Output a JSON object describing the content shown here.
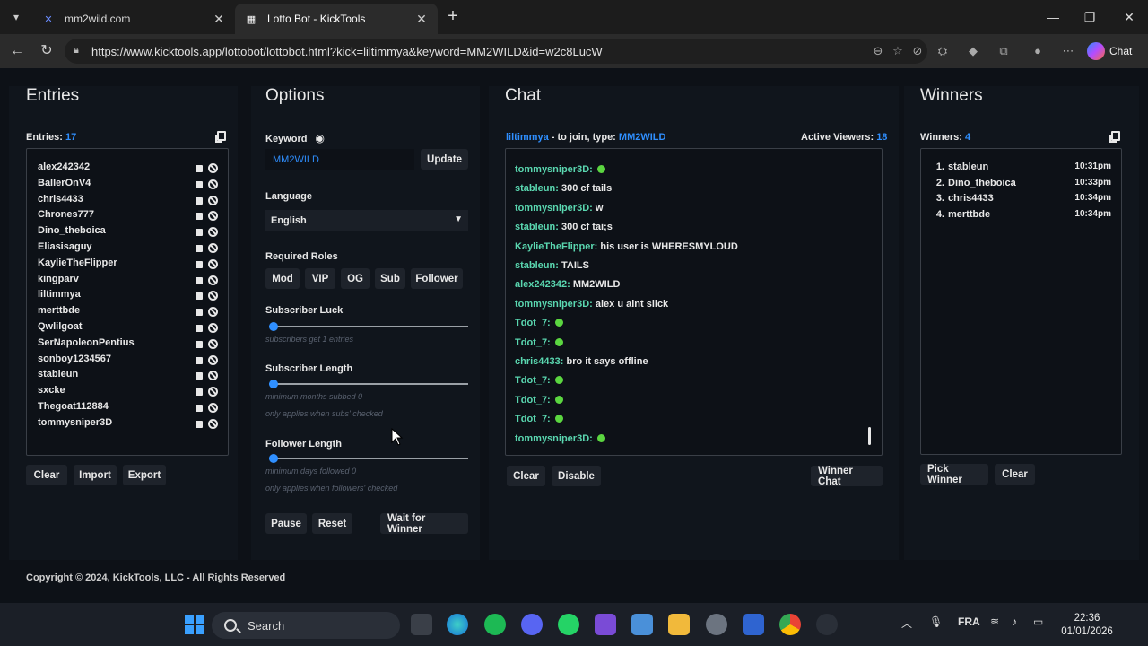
{
  "browser": {
    "tabs": [
      {
        "title": "mm2wild.com"
      },
      {
        "title": "Lotto Bot - KickTools"
      }
    ],
    "url": "https://www.kicktools.app/lottobot/lottobot.html?kick=liltimmya&keyword=MM2WILD&id=w2c8LucW",
    "copilot_label": "Chat"
  },
  "entries": {
    "title": "Entries",
    "count_label": "Entries:",
    "count": "17",
    "items": [
      "alex242342",
      "BallerOnV4",
      "chris4433",
      "Chrones777",
      "Dino_theboica",
      "Eliasisaguy",
      "KaylieTheFlipper",
      "kingparv",
      "liltimmya",
      "merttbde",
      "Qwlilgoat",
      "SerNapoleonPentius",
      "sonboy1234567",
      "stableun",
      "sxcke",
      "Thegoat112884",
      "tommysniper3D"
    ],
    "buttons": {
      "clear": "Clear",
      "import": "Import",
      "export": "Export"
    }
  },
  "options": {
    "title": "Options",
    "keyword_label": "Keyword",
    "keyword_value": "MM2WILD",
    "update_label": "Update",
    "language_label": "Language",
    "language_value": "English",
    "roles_label": "Required Roles",
    "roles": [
      "Mod",
      "VIP",
      "OG",
      "Sub",
      "Follower"
    ],
    "sub_luck_label": "Subscriber Luck",
    "sub_luck_hint": "subscribers get 1 entries",
    "sub_luck_value": 0,
    "sub_length_label": "Subscriber Length",
    "sub_length_hint": "minimum months subbed 0",
    "sub_length_hint2": "only applies when subs' checked",
    "sub_length_value": 0,
    "follower_length_label": "Follower Length",
    "follower_length_hint": "minimum days followed 0",
    "follower_length_hint2": "only applies when followers' checked",
    "follower_length_value": 0,
    "buttons": {
      "pause": "Pause",
      "reset": "Reset",
      "wait": "Wait for Winner"
    }
  },
  "chat": {
    "title": "Chat",
    "channel": "liltimmya",
    "join_text": " - to join, type: ",
    "keyword": "MM2WILD",
    "viewers_label": "Active Viewers:",
    "viewers_count": "18",
    "messages": [
      {
        "user": "tommysniper3D:",
        "text": "",
        "emote": true
      },
      {
        "user": "stableun:",
        "text": "300 cf tails",
        "emote": false
      },
      {
        "user": "tommysniper3D:",
        "text": "w",
        "emote": false
      },
      {
        "user": "stableun:",
        "text": "300 cf tai;s",
        "emote": false
      },
      {
        "user": "KaylieTheFlipper:",
        "text": "his user is WHERESMYLOUD",
        "emote": false
      },
      {
        "user": "stableun:",
        "text": "TAILS",
        "emote": false
      },
      {
        "user": "alex242342:",
        "text": "MM2WILD",
        "emote": false
      },
      {
        "user": "tommysniper3D:",
        "text": "alex u aint slick",
        "emote": false
      },
      {
        "user": "Tdot_7:",
        "text": "",
        "emote": true
      },
      {
        "user": "Tdot_7:",
        "text": "",
        "emote": true
      },
      {
        "user": "chris4433:",
        "text": "bro it says offline",
        "emote": false
      },
      {
        "user": "Tdot_7:",
        "text": "",
        "emote": true
      },
      {
        "user": "Tdot_7:",
        "text": "",
        "emote": true
      },
      {
        "user": "Tdot_7:",
        "text": "",
        "emote": true
      },
      {
        "user": "tommysniper3D:",
        "text": "",
        "emote": true
      }
    ],
    "buttons": {
      "clear": "Clear",
      "disable": "Disable",
      "winner_chat": "Winner Chat"
    }
  },
  "winners": {
    "title": "Winners",
    "count_label": "Winners:",
    "count": "4",
    "items": [
      {
        "rank": "1.",
        "name": "stableun",
        "time": "10:31pm"
      },
      {
        "rank": "2.",
        "name": "Dino_theboica",
        "time": "10:33pm"
      },
      {
        "rank": "3.",
        "name": "chris4433",
        "time": "10:34pm"
      },
      {
        "rank": "4.",
        "name": "merttbde",
        "time": "10:34pm"
      }
    ],
    "buttons": {
      "pick": "Pick Winner",
      "clear": "Clear"
    }
  },
  "footer": "Copyright © 2024, KickTools, LLC - All Rights Reserved",
  "taskbar": {
    "search_label": "Search",
    "lang": "FRA",
    "time": "22:36",
    "date": "01/01/2026"
  },
  "colors": {
    "accent": "#2f8fff",
    "chat_user": "#5ad7b0",
    "background": "#0d1117"
  }
}
